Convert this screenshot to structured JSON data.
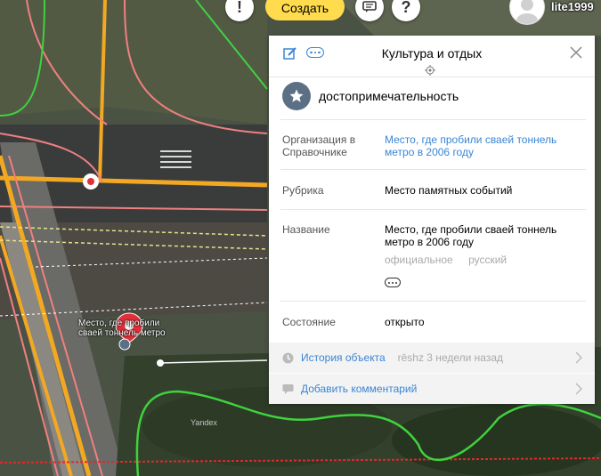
{
  "topbar": {
    "alert_icon": "exclamation-icon",
    "create_label": "Создать",
    "feedback_icon": "chat-icon",
    "help_icon": "question-icon",
    "alert_glyph": "!",
    "help_glyph": "?",
    "username": "lite1999"
  },
  "panel": {
    "title": "Культура и отдых",
    "category": "достопримечательность",
    "fields": {
      "org_label": "Организация в Справочнике",
      "org_value": "Место, где пробили сваей тоннель метро в 2006 году",
      "rubric_label": "Рубрика",
      "rubric_value": "Место памятных событий",
      "name_label": "Название",
      "name_value": "Место, где пробили сваей тоннель метро в 2006 году",
      "name_tag_official": "официальное",
      "name_tag_lang": "русский",
      "state_label": "Состояние",
      "state_value": "открыто"
    },
    "history": {
      "label": "История объекта",
      "meta": "rēshz 3 недели назад"
    },
    "comment": {
      "label": "Добавить комментарий"
    }
  },
  "map": {
    "poi_label": "Место, где пробили сваей тоннель метро",
    "watermark": "Yandex"
  },
  "colors": {
    "accent_yellow": "#ffdb4d",
    "link_blue": "#3a86d4",
    "marker_red": "#e0303a",
    "poi_blue": "#5b6f85"
  }
}
